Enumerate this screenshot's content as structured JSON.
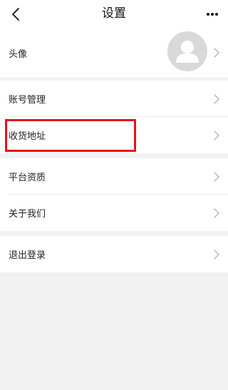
{
  "header": {
    "title": "设置",
    "back_icon": "chevron-left-icon",
    "more_icon": "more-horizontal-icon"
  },
  "avatar_row": {
    "label": "头像",
    "avatar_icon": "user-avatar-placeholder-icon"
  },
  "account_group": {
    "items": [
      {
        "label": "账号管理"
      },
      {
        "label": "收货地址"
      }
    ]
  },
  "info_group": {
    "items": [
      {
        "label": "平台资质"
      },
      {
        "label": "关于我们"
      }
    ]
  },
  "logout_row": {
    "label": "退出登录"
  },
  "colors": {
    "highlight_border": "#e8101a",
    "background": "#f2f2f2",
    "card": "#ffffff"
  }
}
